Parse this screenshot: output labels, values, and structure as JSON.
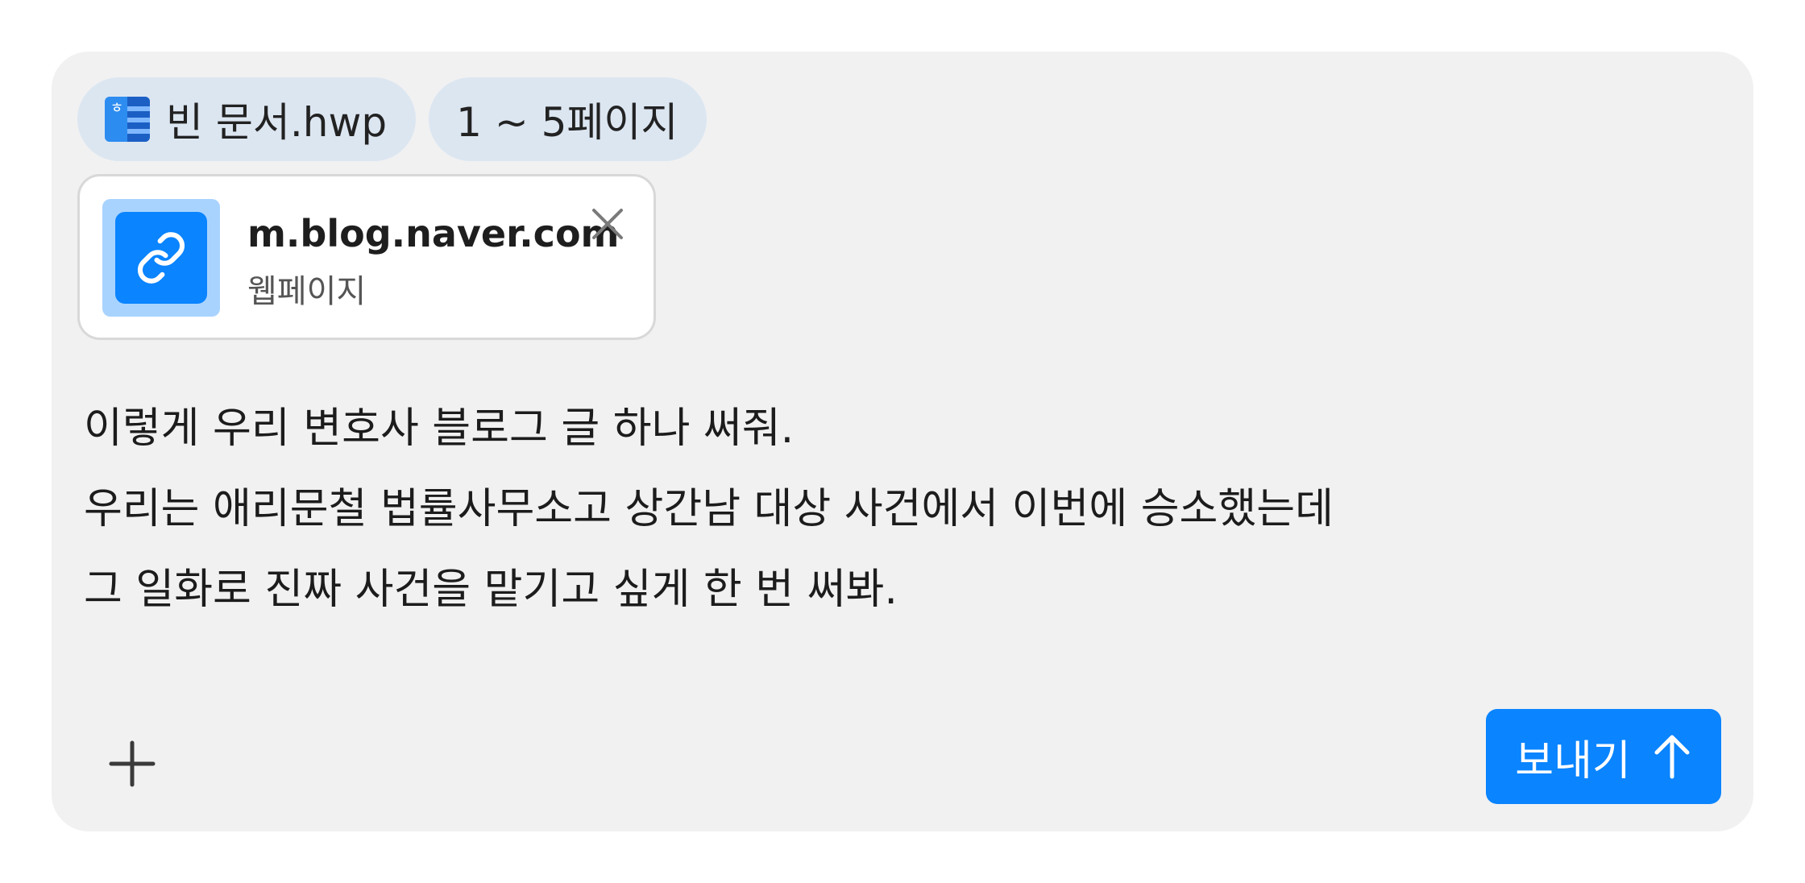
{
  "attachments": {
    "document": {
      "icon": "hwp-document-icon",
      "label": "빈 문서.hwp"
    },
    "page_range": {
      "label": "1 ~ 5페이지"
    }
  },
  "link_card": {
    "icon": "link-icon",
    "title": "m.blog.naver.com",
    "subtitle": "웹페이지",
    "close_icon": "close-icon"
  },
  "prompt": {
    "lines": [
      "이렇게 우리 변호사 블로그 글 하나 써줘.",
      "우리는 애리문철 법률사무소고 상간남 대상 사건에서 이번에 승소했는데",
      "그 일화로 진짜 사건을 맡기고 싶게 한 번 써봐."
    ]
  },
  "toolbar": {
    "add_icon": "plus-icon",
    "send_label": "보내기",
    "send_icon": "arrow-up-icon"
  },
  "colors": {
    "composer_bg": "#f1f1f2",
    "chip_bg": "#dce6f1",
    "accent": "#0a84ff"
  }
}
